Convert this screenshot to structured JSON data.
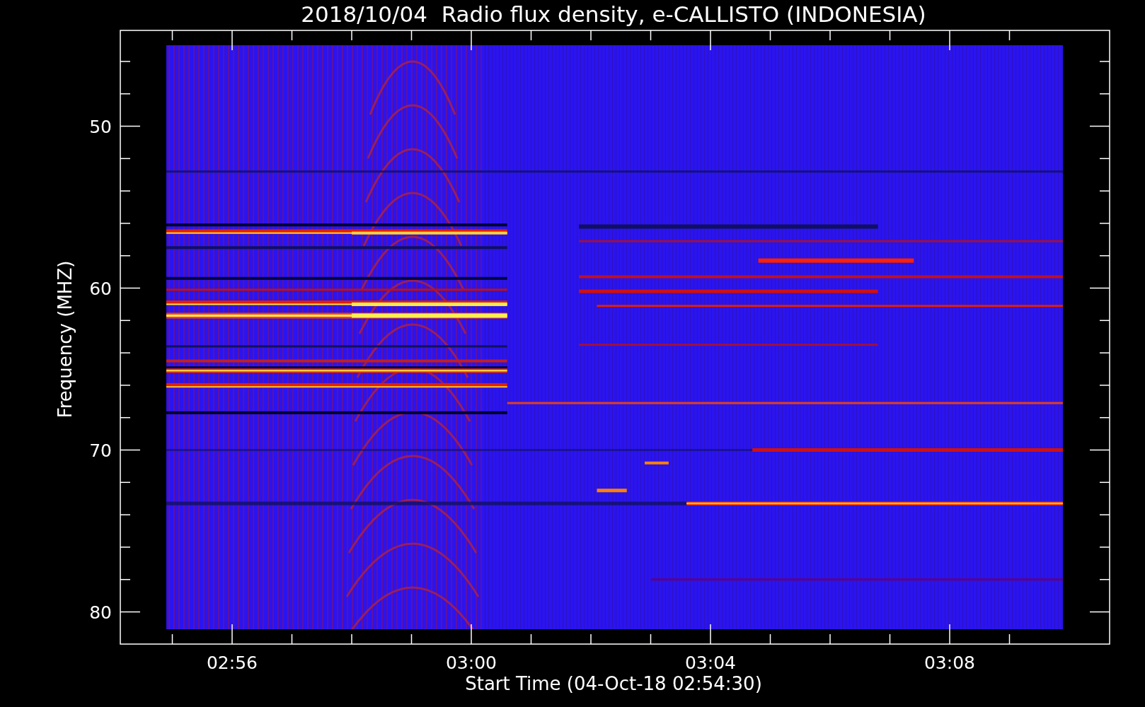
{
  "title": "2018/10/04  Radio flux density, e-CALLISTO (INDONESIA)",
  "x_axis": {
    "label": "Start Time (04-Oct-18 02:54:30)",
    "ticks": [
      "02:56",
      "03:00",
      "03:04",
      "03:08"
    ]
  },
  "y_axis": {
    "label": "Frequency (MHZ)",
    "ticks": [
      "50",
      "60",
      "70",
      "80"
    ]
  }
}
